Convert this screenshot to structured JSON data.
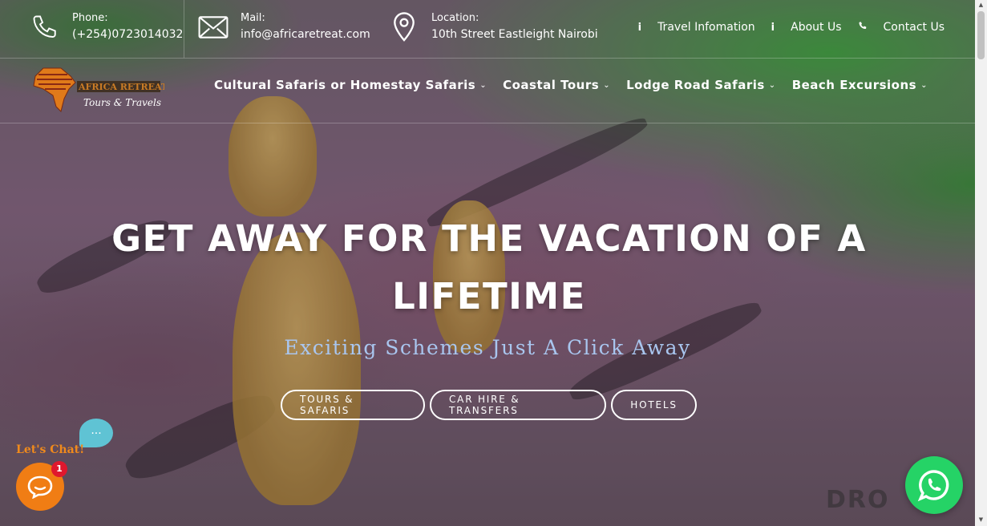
{
  "topbar": {
    "phone": {
      "label": "Phone:",
      "value": "(+254)0723014032",
      "icon": "phone-icon"
    },
    "mail": {
      "label": "Mail:",
      "value": "info@africaretreat.com",
      "icon": "mail-icon"
    },
    "location": {
      "label": "Location:",
      "value": "10th Street Eastleight Nairobi",
      "icon": "location-pin-icon"
    },
    "links": [
      {
        "label": "Travel Infomation",
        "icon": "info-icon"
      },
      {
        "label": "About Us",
        "icon": "info-icon"
      },
      {
        "label": "Contact Us",
        "icon": "phone-icon"
      }
    ]
  },
  "logo": {
    "name": "AFRICA RETREAT",
    "tagline": "Tours & Travels"
  },
  "nav": {
    "items": [
      {
        "label": "Cultural Safaris or Homestay Safaris"
      },
      {
        "label": "Coastal Tours"
      },
      {
        "label": "Lodge Road Safaris"
      },
      {
        "label": "Beach Excursions"
      }
    ]
  },
  "hero": {
    "headline_line1": "GET AWAY FOR THE VACATION OF A",
    "headline_line2": "LIFETIME",
    "subheadline": "Exciting Schemes Just A Click Away",
    "buttons": [
      {
        "label": "TOURS & SAFARIS"
      },
      {
        "label": "CAR HIRE & TRANSFERS"
      },
      {
        "label": "HOTELS"
      }
    ]
  },
  "chat": {
    "bubble_text": "...",
    "lets_chat": "Let's Chat!",
    "badge_count": "1"
  },
  "watermark": "DRO",
  "colors": {
    "accent_orange": "#f07d14",
    "whatsapp_green": "#25d366",
    "subheadline_blue": "#a9c6ef",
    "badge_red": "#e0182d"
  }
}
